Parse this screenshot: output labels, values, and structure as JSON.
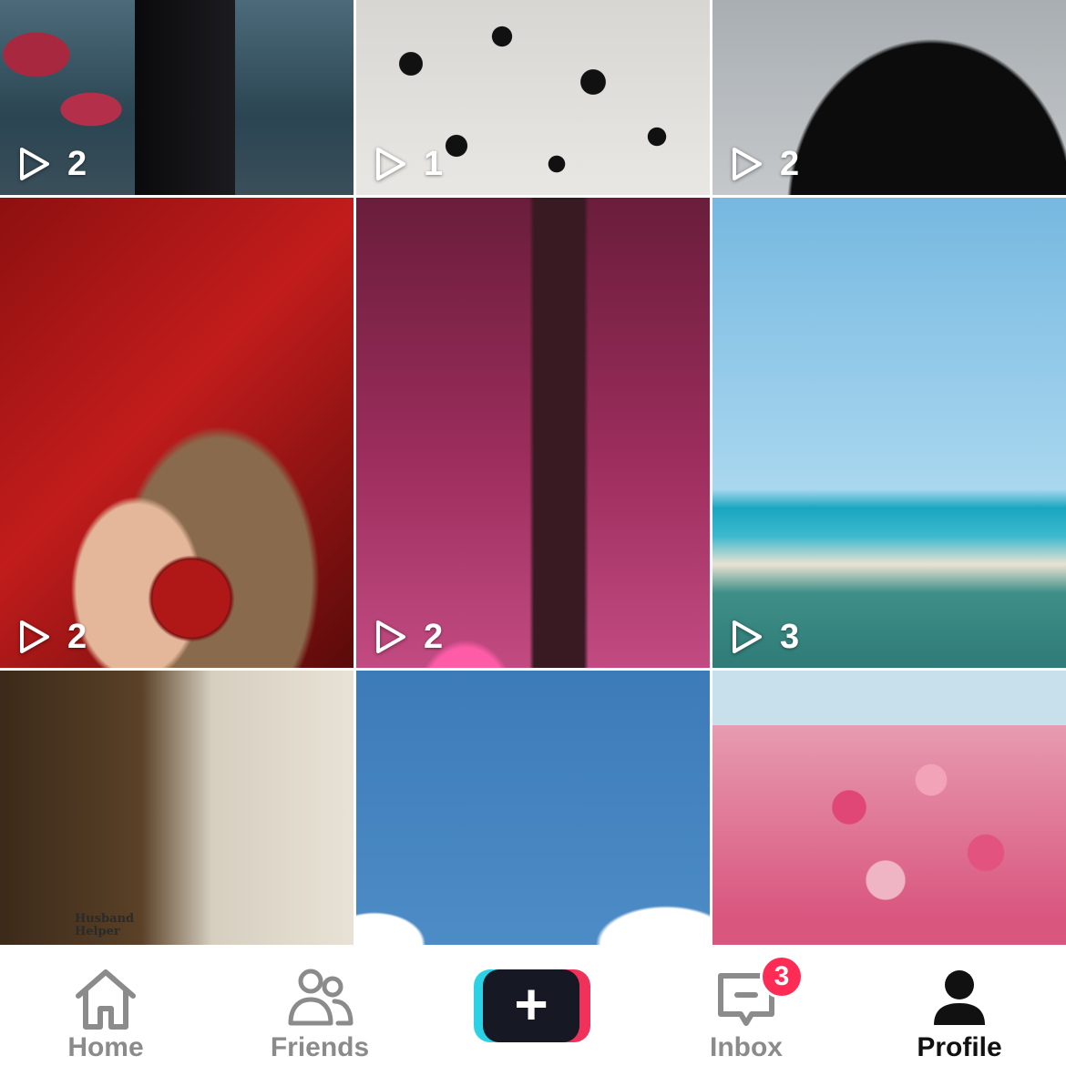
{
  "grid": {
    "tiles": [
      {
        "views": "2"
      },
      {
        "views": "1"
      },
      {
        "views": "2"
      },
      {
        "views": "2"
      },
      {
        "views": "2"
      },
      {
        "views": "3"
      },
      {
        "views": ""
      },
      {
        "views": ""
      },
      {
        "views": ""
      }
    ],
    "tile7_robot_sign": "Husband Helper"
  },
  "nav": {
    "home_label": "Home",
    "friends_label": "Friends",
    "create_icon": "plus-icon",
    "inbox_label": "Inbox",
    "inbox_badge": "3",
    "profile_label": "Profile",
    "active": "Profile"
  },
  "colors": {
    "active_label": "#111111",
    "inactive_label": "#8b8b8b",
    "badge": "#fe2c55",
    "create_cyan": "#2bd2e6",
    "create_pink": "#f0315a",
    "create_core": "#161823"
  }
}
